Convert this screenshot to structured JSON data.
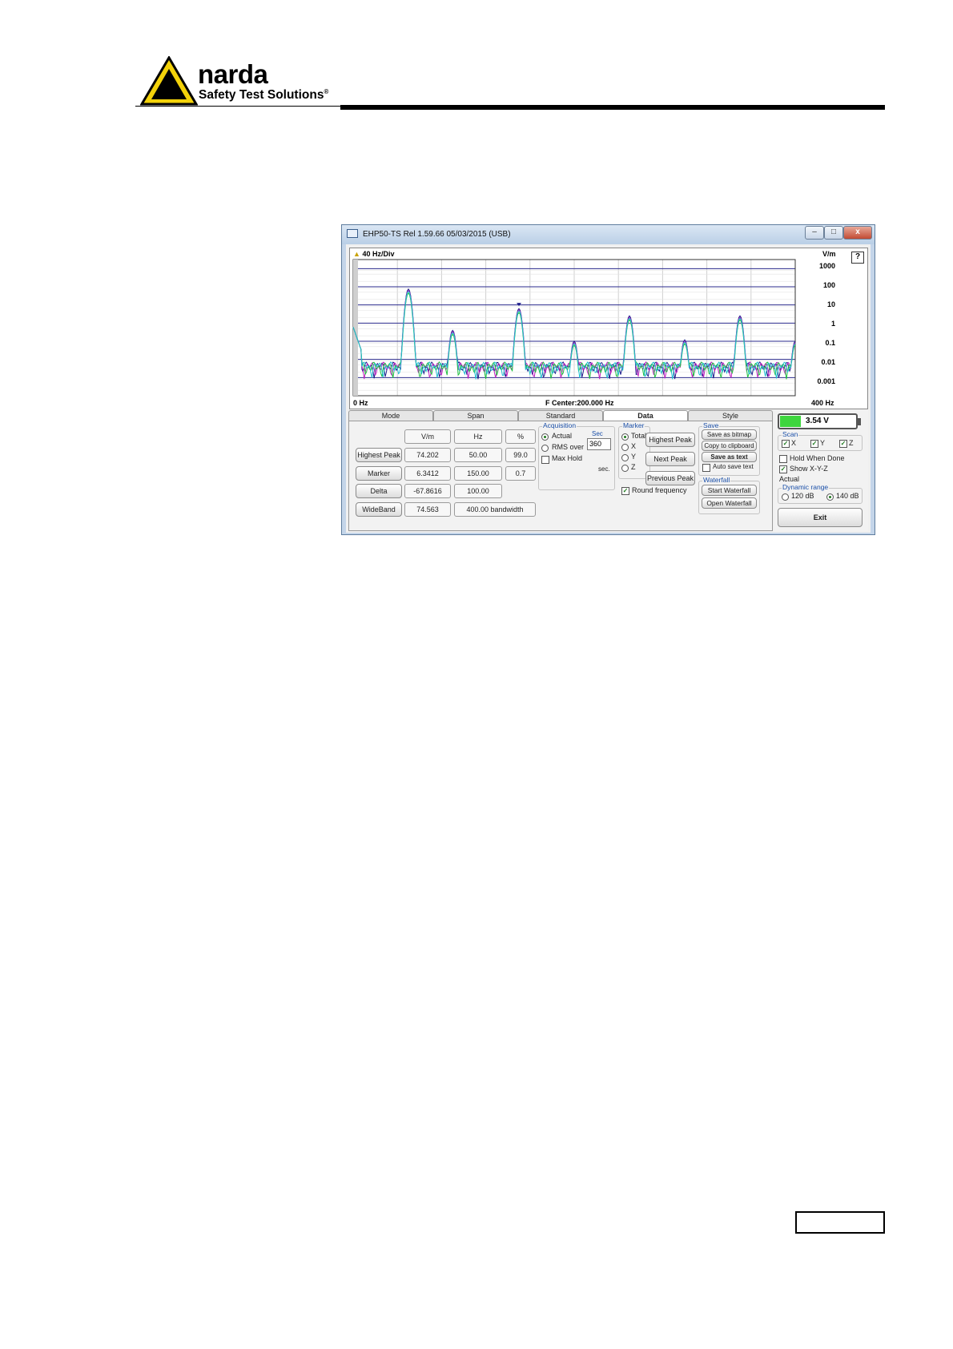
{
  "header": {
    "brand": "narda",
    "tagline": "Safety Test Solutions",
    "registered": "®"
  },
  "window": {
    "title": "EHP50-TS Rel 1.59.66 05/03/2015 (USB)",
    "min_label": "–",
    "max_label": "□",
    "close_label": "x"
  },
  "plot": {
    "div_label": "40 Hz/Div",
    "unit": "V/m",
    "help": "?",
    "x_left": "0 Hz",
    "x_center": "F Center:200.000 Hz",
    "x_right": "400 Hz",
    "yticks": [
      "1000",
      "100",
      "10",
      "1",
      "0.1",
      "0.01",
      "0.001"
    ]
  },
  "chart_data": {
    "type": "line",
    "xlabel": "",
    "ylabel": "V/m",
    "x_range": [
      0,
      400
    ],
    "y_scale": "log",
    "grid": true,
    "peaks": [
      {
        "freq": 50,
        "value": 74.202
      },
      {
        "freq": 90,
        "value": 0.4
      },
      {
        "freq": 150,
        "value": 6.3412
      },
      {
        "freq": 200,
        "value": 0.1
      },
      {
        "freq": 250,
        "value": 2.5
      },
      {
        "freq": 300,
        "value": 0.12
      },
      {
        "freq": 350,
        "value": 2.5
      },
      {
        "freq": 400,
        "value": 0.1
      }
    ],
    "series": [
      {
        "color": "#1e1e8c"
      },
      {
        "color": "#c020c0"
      },
      {
        "color": "#20c040"
      },
      {
        "color": "#20c0d0"
      }
    ]
  },
  "tabs": [
    "Mode",
    "Span",
    "Standard",
    "Data",
    "Style"
  ],
  "active_tab": "Data",
  "table": {
    "headers": [
      "V/m",
      "Hz",
      "%"
    ],
    "rows": [
      {
        "label": "Highest Peak",
        "vm": "74.202",
        "hz": "50.00",
        "pct": "99.0"
      },
      {
        "label": "Marker",
        "vm": "6.3412",
        "hz": "150.00",
        "pct": "0.7"
      },
      {
        "label": "Delta",
        "vm": "-67.8616",
        "hz": "100.00",
        "pct": ""
      },
      {
        "label": "WideBand",
        "vm": "74.563",
        "hz": "400.00 bandwidth",
        "pct": ""
      }
    ]
  },
  "acquisition": {
    "title": "Acquisition",
    "actual": "Actual",
    "rms_over": "RMS over",
    "max_hold": "Max Hold",
    "sec_label": "Sec",
    "sec_value": "360",
    "sec_unit": "sec."
  },
  "marker": {
    "title": "Marker",
    "options": [
      "Total",
      "X",
      "Y",
      "Z"
    ],
    "selected": "Total",
    "highest_peak": "Highest Peak",
    "next_peak": "Next Peak",
    "previous_peak": "Previous  Peak",
    "round_frequency": "Round frequency"
  },
  "save": {
    "title": "Save",
    "bitmap": "Save as bitmap",
    "clipboard": "Copy to clipboard",
    "text": "Save as text",
    "auto": "Auto save text"
  },
  "waterfall": {
    "title": "Waterfall",
    "start": "Start Waterfall",
    "open": "Open Waterfall"
  },
  "right_panel": {
    "battery_text": "3.54 V",
    "battery_level": 0.28,
    "scan_title": "Scan",
    "scan_x": "X",
    "scan_y": "Y",
    "scan_z": "Z",
    "hold_when_done": "Hold When Done",
    "show_xyz": "Show X-Y-Z",
    "actual": "Actual",
    "dynamic_title": "Dynamic range",
    "dr_120": "120 dB",
    "dr_140": "140 dB",
    "exit": "Exit"
  }
}
